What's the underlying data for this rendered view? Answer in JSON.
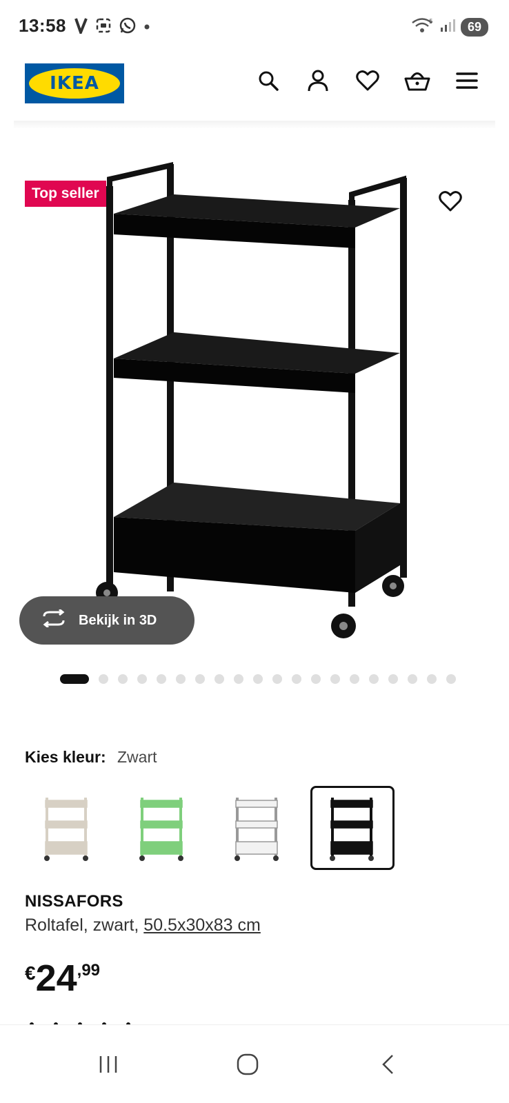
{
  "status_bar": {
    "time": "13:58",
    "battery": "69",
    "left_icons": [
      "v-app-icon",
      "screenshot-icon",
      "whatsapp-icon",
      "notification-dot-icon"
    ],
    "right_icons": [
      "wifi-icon",
      "signal-icon",
      "battery-icon"
    ]
  },
  "header": {
    "logo_text": "IKEA",
    "icons": [
      "search-icon",
      "profile-icon",
      "heart-icon",
      "basket-icon",
      "menu-icon"
    ]
  },
  "gallery": {
    "badge": "Top seller",
    "view_3d_label": "Bekijk in 3D",
    "image_count": 20,
    "active_index": 0
  },
  "color_picker": {
    "label": "Kies kleur:",
    "selected": "Zwart",
    "swatches": [
      {
        "color": "#d7d0c4",
        "selected": false
      },
      {
        "color": "#7fcf7c",
        "selected": false
      },
      {
        "color": "#f2f2f2",
        "selected": false
      },
      {
        "color": "#111111",
        "selected": true
      }
    ]
  },
  "product": {
    "name": "NISSAFORS",
    "description": "Roltafel, zwart,",
    "dimensions": "50.5x30x83 cm",
    "price_currency": "€",
    "price_integer": "24",
    "price_decimal": ",99"
  },
  "colors": {
    "ikea_blue": "#0058a3",
    "ikea_yellow": "#ffdb00",
    "badge_red": "#e00751"
  },
  "navbar": {
    "icons": [
      "recent-apps-icon",
      "home-icon",
      "back-icon"
    ]
  }
}
